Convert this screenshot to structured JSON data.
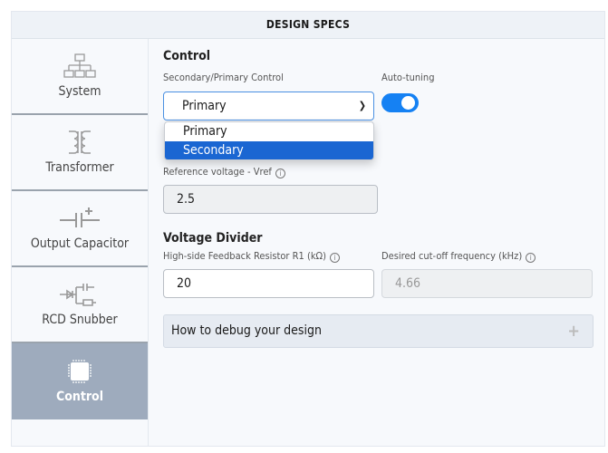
{
  "header": {
    "title": "DESIGN SPECS"
  },
  "sidebar": {
    "items": [
      {
        "label": "System",
        "icon": "system-hierarchy-icon",
        "active": false
      },
      {
        "label": "Transformer",
        "icon": "transformer-icon",
        "active": false
      },
      {
        "label": "Output Capacitor",
        "icon": "capacitor-icon",
        "active": false
      },
      {
        "label": "RCD Snubber",
        "icon": "rcd-snubber-icon",
        "active": false
      },
      {
        "label": "Control",
        "icon": "chip-icon",
        "active": true
      }
    ]
  },
  "control": {
    "title": "Control",
    "select_label": "Secondary/Primary Control",
    "select_value": "Primary",
    "options": [
      "Primary",
      "Secondary"
    ],
    "highlighted_option": "Secondary",
    "autotune_label": "Auto-tuning",
    "autotune_on": true
  },
  "vref": {
    "label": "Reference voltage - Vref",
    "value": "2.5"
  },
  "divider": {
    "title": "Voltage Divider",
    "r1_label": "High-side Feedback Resistor R1 (kΩ)",
    "r1_value": "20",
    "fc_label": "Desired cut-off frequency (kHz)",
    "fc_value": "4.66"
  },
  "accordion": {
    "label": "How to debug your design"
  },
  "colors": {
    "accent": "#1581f3",
    "active_tab": "#9eabbd",
    "selected_option": "#1a66d2"
  }
}
